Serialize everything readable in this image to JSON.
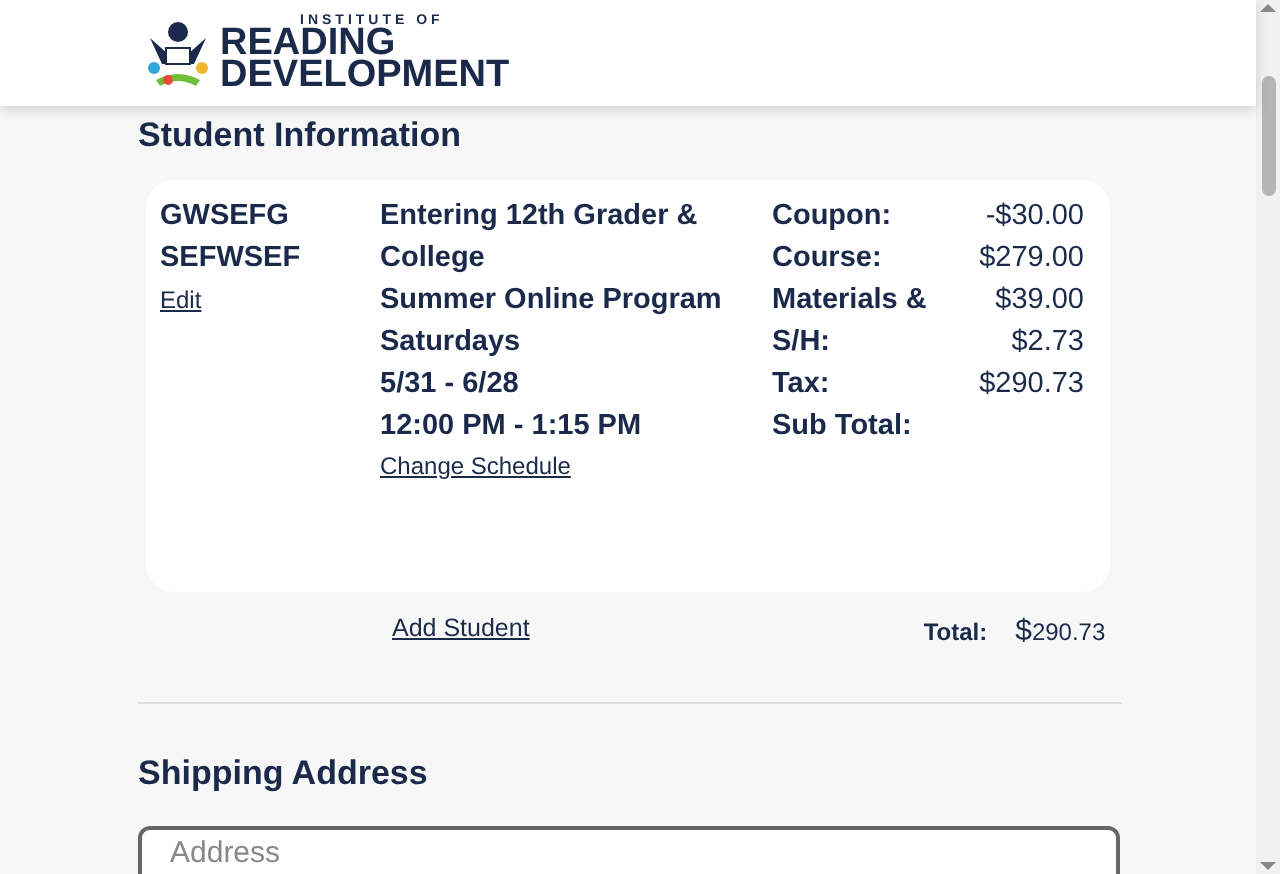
{
  "logo": {
    "small": "INSTITUTE OF",
    "line_1": "READING",
    "line_2": "DEVELOPMENT"
  },
  "section_title": "Student Information",
  "student": {
    "name_lines": [
      "GWSEFG",
      "SEFWSEF"
    ],
    "edit_link": "Edit",
    "course_lines": [
      "Entering 12th Grader &",
      "College",
      "Summer Online Program",
      "Saturdays",
      "5/31 - 6/28",
      "12:00 PM - 1:15 PM"
    ],
    "change_link": "Change Schedule",
    "price_rows": [
      {
        "label": "Coupon:",
        "value": "-$30.00"
      },
      {
        "label": "Course:",
        "value": "$279.00"
      },
      {
        "label": "Materials &",
        "value": "$39.00"
      },
      {
        "label": "S/H:",
        "value": "$2.73"
      },
      {
        "label": "Tax:",
        "value": "$290.73"
      },
      {
        "label": "Sub Total:"
      }
    ]
  },
  "add_student": "Add Student",
  "total": {
    "label": "Total:",
    "currency": "$",
    "amount": "290.73"
  },
  "shipping": {
    "title": "Shipping Address",
    "address": {
      "placeholder": "Address"
    }
  }
}
